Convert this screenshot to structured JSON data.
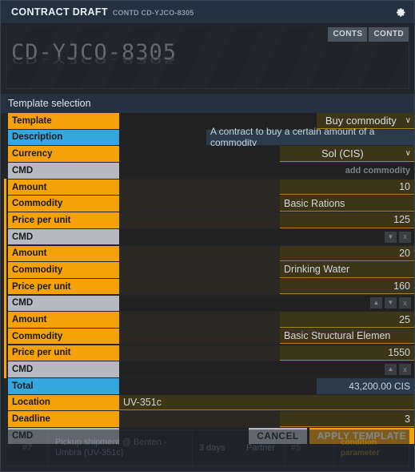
{
  "window": {
    "title": "CONTRACT DRAFT",
    "subtitle": "CONTD CD-YJCO-8305",
    "gear_icon": "gear-icon"
  },
  "banner": {
    "code": "CD-YJCO-8305",
    "tabs": [
      {
        "label": "CONTS"
      },
      {
        "label": "CONTD"
      }
    ]
  },
  "section": {
    "title": "Template selection"
  },
  "form": {
    "template": {
      "label": "Template",
      "value": "Buy commodity",
      "chevron": "∨"
    },
    "description": {
      "label": "Description",
      "value": "A contract to buy a certain amount of a commodity"
    },
    "currency": {
      "label": "Currency",
      "value": "Sol (CIS)",
      "chevron": "∨"
    },
    "add_commodity_cmd": {
      "label": "CMD",
      "action": "add commodity"
    },
    "commodities": [
      {
        "amount_label": "Amount",
        "amount_value": "10",
        "commodity_label": "Commodity",
        "commodity_value": "Basic Rations",
        "price_label": "Price per unit",
        "price_value": "125",
        "cmd_label": "CMD",
        "buttons": [
          "down",
          "remove"
        ]
      },
      {
        "amount_label": "Amount",
        "amount_value": "20",
        "commodity_label": "Commodity",
        "commodity_value": "Drinking Water",
        "price_label": "Price per unit",
        "price_value": "160",
        "cmd_label": "CMD",
        "buttons": [
          "up",
          "down",
          "remove"
        ]
      },
      {
        "amount_label": "Amount",
        "amount_value": "25",
        "commodity_label": "Commodity",
        "commodity_value": "Basic Structural Elemen",
        "price_label": "Price per unit",
        "price_value": "1550",
        "cmd_label": "CMD",
        "buttons": [
          "up",
          "remove"
        ]
      }
    ],
    "total": {
      "label": "Total",
      "value": "43,200.00 CIS"
    },
    "location": {
      "label": "Location",
      "value": "UV-351c"
    },
    "deadline": {
      "label": "Deadline",
      "value": "3"
    },
    "actions_cmd": {
      "label": "CMD",
      "cancel": "CANCEL",
      "apply": "APPLY TEMPLATE"
    }
  },
  "footer_row": {
    "id": "#7",
    "description": "Pickup shipment @ Benten - Umbra (UV-351c)",
    "duration": "3 days",
    "type": "Partner",
    "ref": "#5",
    "condition": "condition parameter"
  },
  "colors": {
    "accent_orange": "#f5a20a",
    "accent_blue": "#34a7e0",
    "cmd_grey": "#b6bac0",
    "panel_bg": "#222529",
    "titlebar_bg": "#253040"
  }
}
